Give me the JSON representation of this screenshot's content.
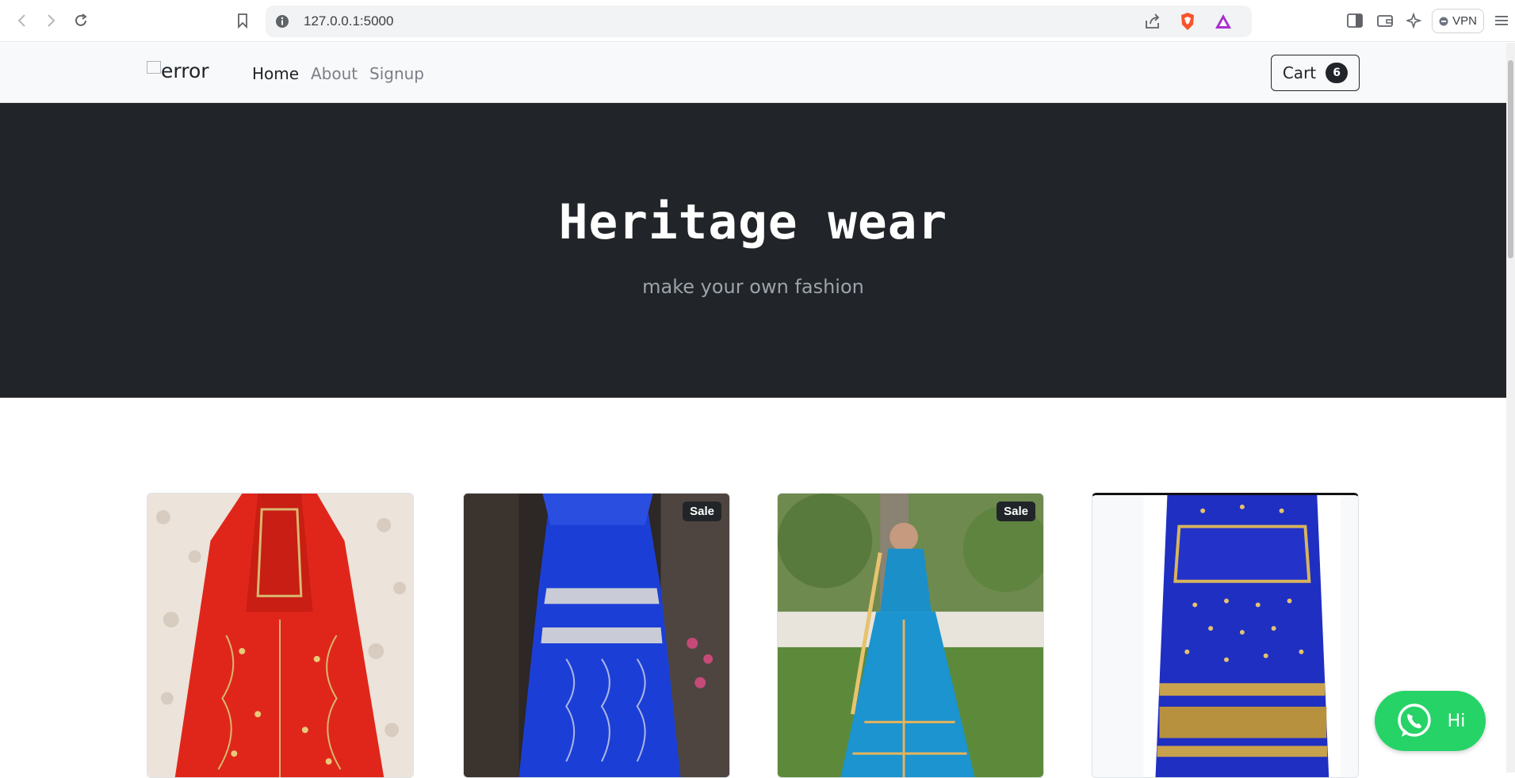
{
  "browser": {
    "url": "127.0.0.1:5000",
    "vpn_label": "VPN",
    "icons": [
      "back-icon",
      "forward-icon",
      "reload-icon",
      "bookmark-icon",
      "site-info-icon",
      "share-icon",
      "brave-shields-icon",
      "brave-rewards-icon",
      "sidebar-icon",
      "wallet-icon",
      "leo-ai-icon",
      "menu-icon"
    ]
  },
  "navbar": {
    "logo_alt": "error",
    "links": [
      {
        "label": "Home",
        "active": true
      },
      {
        "label": "About",
        "active": false
      },
      {
        "label": "Signup",
        "active": false
      }
    ],
    "cart_label": "Cart",
    "cart_count": "6"
  },
  "hero": {
    "title": "Heritage wear",
    "subtitle": "make your own fashion"
  },
  "products": [
    {
      "image": "red lehenga with gold embroidery",
      "sale": false
    },
    {
      "image": "royal blue lehenga with silver dupatta",
      "sale": true,
      "badge": "Sale"
    },
    {
      "image": "woman in turquoise lehenga in garden",
      "sale": true,
      "badge": "Sale"
    },
    {
      "image": "blue lehenga with gold sequin work",
      "sale": false
    }
  ],
  "whatsapp": {
    "label": "Hi",
    "icon": "whatsapp-icon",
    "color": "#25d366"
  },
  "colors": {
    "hero_bg": "#212529",
    "navbar_bg": "#f8f9fa"
  }
}
